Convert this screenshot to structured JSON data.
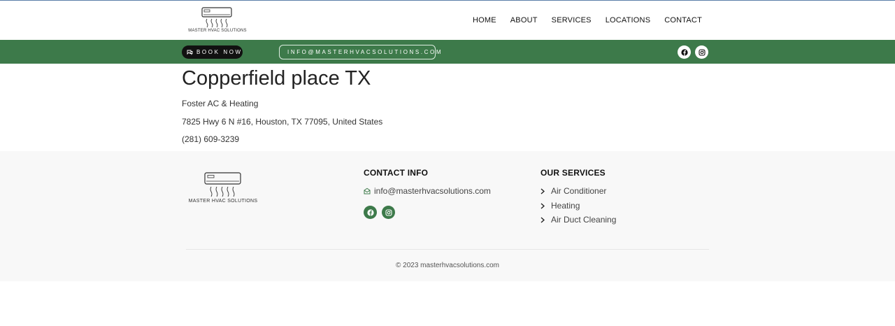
{
  "header": {
    "logo_text": "MASTER HVAC SOLUTIONS",
    "nav": [
      "HOME",
      "ABOUT",
      "SERVICES",
      "LOCATIONS",
      "CONTACT"
    ]
  },
  "topbar": {
    "book_label": "BOOK NOW",
    "email_label": "INFO@MASTERHVACSOLUTIONS.COM",
    "social": [
      "facebook-icon",
      "instagram-icon"
    ],
    "accent": "#3d7a4a"
  },
  "main": {
    "title": "Copperfield place TX",
    "business": "Foster AC & Heating",
    "address": "7825 Hwy 6 N #16, Houston, TX 77095, United States",
    "phone": "(281) 609-3239"
  },
  "footer": {
    "logo_text": "MASTER HVAC SOLUTIONS",
    "contact_heading": "CONTACT INFO",
    "email": "info@masterhvacsolutions.com",
    "services_heading": "OUR SERVICES",
    "services": [
      "Air Conditioner",
      "Heating",
      "Air Duct Cleaning"
    ],
    "copyright": "© 2023 masterhvacsolutions.com"
  }
}
